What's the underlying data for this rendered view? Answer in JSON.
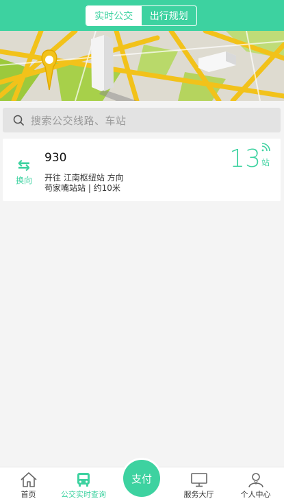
{
  "header": {
    "tabs": [
      {
        "label": "实时公交",
        "active": true
      },
      {
        "label": "出行规划",
        "active": false
      }
    ],
    "accent_color": "#3dd2a0"
  },
  "search": {
    "placeholder": "搜索公交线路、车站",
    "icon": "search-icon"
  },
  "bus_card": {
    "switch_label": "换向",
    "switch_icon": "swap-arrows-icon",
    "route": "930",
    "direction": "开往 江南枢纽站 方向",
    "station_info": "苟家嘴站站 | 约10米",
    "stops_count": "13",
    "stops_unit": "站",
    "realtime_icon": "signal-icon"
  },
  "bottom_nav": {
    "items": [
      {
        "label": "首页",
        "icon": "home-icon"
      },
      {
        "label": "公交实时查询",
        "icon": "bus-icon",
        "active": true
      },
      {
        "label": "支付",
        "icon": "pay-button"
      },
      {
        "label": "服务大厅",
        "icon": "monitor-icon"
      },
      {
        "label": "个人中心",
        "icon": "person-icon"
      }
    ]
  }
}
